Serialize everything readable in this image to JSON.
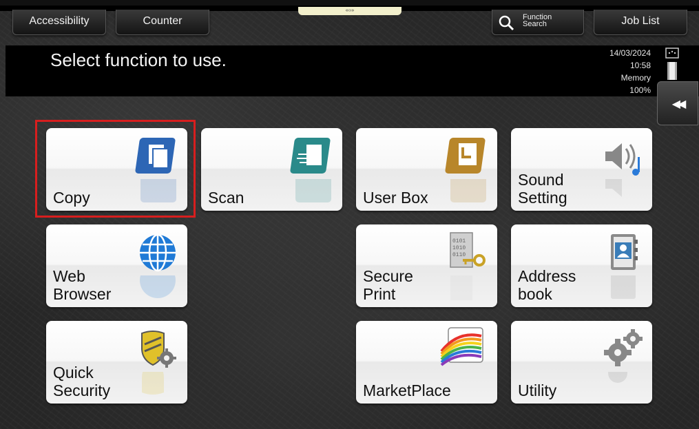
{
  "topbar": {
    "accessibility_label": "Accessibility",
    "counter_label": "Counter",
    "function_search_line1": "Function",
    "function_search_line2": "Search",
    "job_list_label": "Job List",
    "handle_glyph": "«‹›»"
  },
  "header": {
    "title": "Select function to use.",
    "date": "14/03/2024",
    "time": "10:58",
    "memory_label": "Memory",
    "memory_value": "100%"
  },
  "side": {
    "collapse_glyph": "◀◀"
  },
  "tiles": [
    {
      "label": "Copy",
      "icon": "copy-icon"
    },
    {
      "label": "Scan",
      "icon": "scan-icon"
    },
    {
      "label": "User Box",
      "icon": "user-box-icon"
    },
    {
      "label": "Sound\nSetting",
      "icon": "sound-icon"
    },
    {
      "label": "Web\nBrowser",
      "icon": "globe-icon"
    },
    {
      "label": "Secure\nPrint",
      "icon": "secure-print-icon"
    },
    {
      "label": "Address\nbook",
      "icon": "address-book-icon"
    },
    {
      "label": "Quick\nSecurity",
      "icon": "shield-gear-icon"
    },
    {
      "label": "MarketPlace",
      "icon": "marketplace-icon"
    },
    {
      "label": "Utility",
      "icon": "gears-icon"
    }
  ],
  "colors": {
    "highlight": "#d81e1e",
    "copy_icon": "#2d66b5",
    "scan_icon": "#2a8a8a",
    "userbox_icon": "#b8862a"
  }
}
